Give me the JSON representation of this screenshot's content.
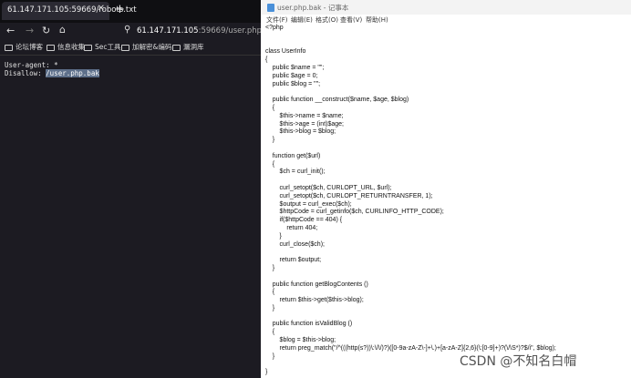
{
  "browser": {
    "tab_title": "61.147.171.105:59669/robots.txt",
    "tab_close": "✕",
    "new_tab": "+",
    "url_host": "61.147.171.105",
    "url_rest": ":59669/user.php.bak",
    "bookmarks": [
      "论坛博客",
      "信息收集",
      "Sec工具",
      "加解密&编码",
      "漏洞库"
    ],
    "robots_line1": "User-agent: *",
    "robots_line2_prefix": "Disallow: ",
    "robots_line2_highlight": "/user.php.bak"
  },
  "notepad": {
    "title": "user.php.bak - 记事本",
    "menu": [
      "文件(F)",
      "编辑(E)",
      "格式(O)",
      "查看(V)",
      "帮助(H)"
    ],
    "content": "<?php\n\n\nclass UserInfo\n{\n    public $name = \"\";\n    public $age = 0;\n    public $blog = \"\";\n\n    public function __construct($name, $age, $blog)\n    {\n        $this->name = $name;\n        $this->age = (int)$age;\n        $this->blog = $blog;\n    }\n\n    function get($url)\n    {\n        $ch = curl_init();\n\n        curl_setopt($ch, CURLOPT_URL, $url);\n        curl_setopt($ch, CURLOPT_RETURNTRANSFER, 1);\n        $output = curl_exec($ch);\n        $httpCode = curl_getinfo($ch, CURLINFO_HTTP_CODE);\n        if($httpCode == 404) {\n            return 404;\n        }\n        curl_close($ch);\n\n        return $output;\n    }\n\n    public function getBlogContents ()\n    {\n        return $this->get($this->blog);\n    }\n\n    public function isValidBlog ()\n    {\n        $blog = $this->blog;\n        return preg_match(\"/^(((http(s?))\\:\\/\\/)?)([0-9a-zA-Z\\-]+\\.)+[a-zA-Z]{2,6}(\\:[0-9]+)?(\\/\\S*)?$/i\", $blog);\n    }\n\n}"
  },
  "watermark": "CSDN @不知名白帽"
}
